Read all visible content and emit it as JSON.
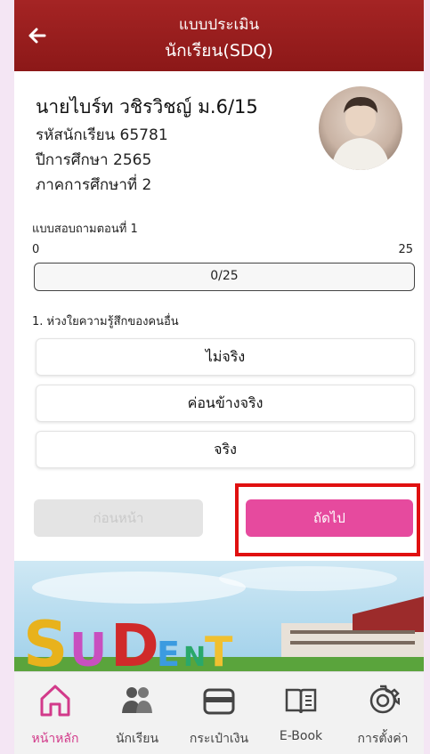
{
  "header": {
    "title_line1": "แบบประเมิน",
    "title_line2": "นักเรียน(SDQ)",
    "back_icon": "arrow-left-icon"
  },
  "student": {
    "name": "นายไบร์ท วชิรวิชญ์ ม.6/15",
    "id_line": "รหัสนักเรียน 65781",
    "year_line": "ปีการศึกษา 2565",
    "term_line": "ภาคการศึกษาที่ 2"
  },
  "quiz": {
    "section_title": "แบบสอบถามตอนที่ 1",
    "range_min": "0",
    "range_max": "25",
    "progress_text": "0/25",
    "progress_fraction": 0,
    "question": "1. ห่วงใยความรู้สึกของคนอื่น",
    "options": [
      "ไม่จริง",
      "ค่อนข้างจริง",
      "จริง"
    ],
    "prev_label": "ก่อนหน้า",
    "next_label": "ถัดไป"
  },
  "colors": {
    "header": "#9c1f1f",
    "accent": "#e64a9e",
    "highlight": "#e01010"
  },
  "tabbar": {
    "items": [
      {
        "label": "หน้าหลัก",
        "icon": "home-icon",
        "active": true
      },
      {
        "label": "นักเรียน",
        "icon": "students-icon",
        "active": false
      },
      {
        "label": "กระเป๋าเงิน",
        "icon": "wallet-icon",
        "active": false
      },
      {
        "label": "E-Book",
        "icon": "book-icon",
        "active": false
      },
      {
        "label": "การตั้งค่า",
        "icon": "gear-icon",
        "active": false
      }
    ]
  }
}
